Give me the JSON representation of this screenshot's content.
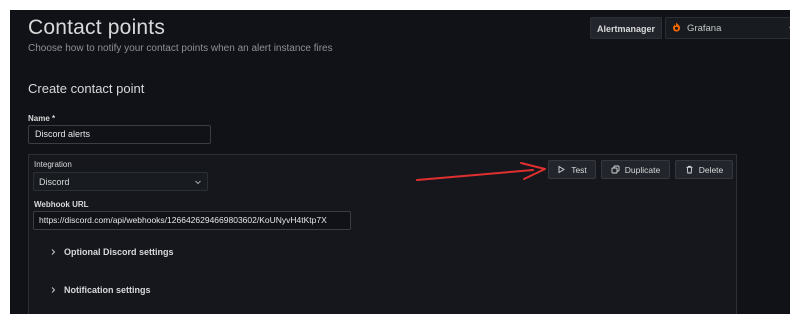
{
  "header": {
    "title": "Contact points",
    "subtitle": "Choose how to notify your contact points when an alert instance fires",
    "alertmanager_label": "Alertmanager",
    "alertmanager_value": "Grafana"
  },
  "form": {
    "section_title": "Create contact point",
    "name_label": "Name *",
    "name_value": "Discord alerts",
    "integration": {
      "label": "Integration",
      "value": "Discord",
      "webhook_label": "Webhook URL",
      "webhook_value": "https://discord.com/api/webhooks/1266426294669803602/KoUNyvH4tKtp7X",
      "optional_settings_label": "Optional Discord settings",
      "notification_settings_label": "Notification settings"
    },
    "buttons": {
      "test": "Test",
      "duplicate": "Duplicate",
      "delete": "Delete"
    }
  },
  "colors": {
    "background": "#111217",
    "annotation_arrow": "#e02f2f",
    "grafana_flame": "#f46800"
  },
  "icons": {
    "alertmanager": "grafana-flame-icon",
    "dropdown": "chevron-down-icon",
    "collapse": "chevron-right-icon",
    "test": "play-outline-icon",
    "duplicate": "copy-icon",
    "delete": "trash-icon"
  }
}
